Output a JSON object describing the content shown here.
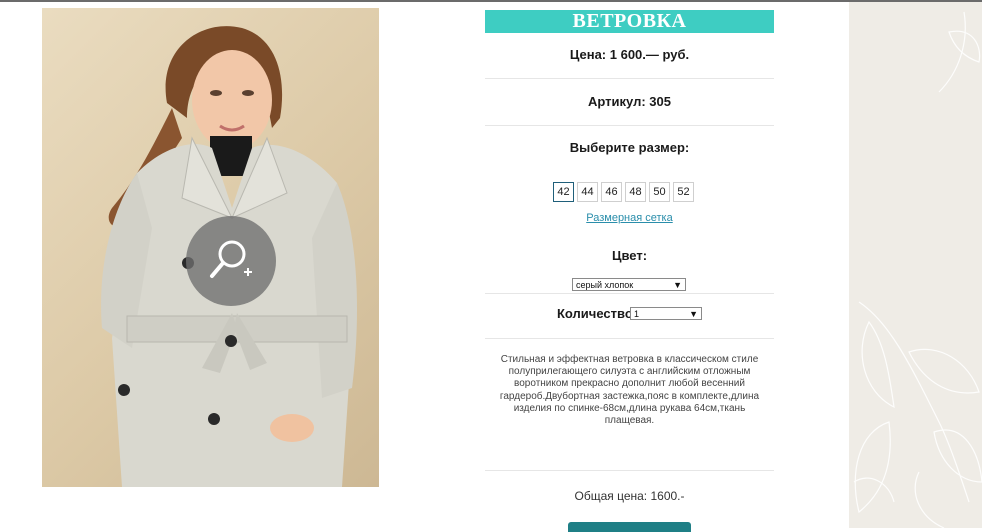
{
  "product": {
    "title": "ВЕТРОВКА",
    "price": "Цена: 1 600.— руб.",
    "article": "Артикул: 305",
    "choose_size_label": "Выберите размер:",
    "sizes": [
      "42",
      "44",
      "46",
      "48",
      "50",
      "52"
    ],
    "selected_size": "42",
    "size_chart_link": "Размерная сетка",
    "color_label": "Цвет:",
    "color_value": "серый хлопок",
    "quantity_label": "Количество:",
    "quantity_value": "1",
    "description": "Стильная и эффектная ветровка в классическом стиле полуприлегающего силуэта с английским отложным воротником прекрасно дополнит любой весенний гардероб.Двубортная застежка,пояс в комплекте,длина изделия по спинке-68см,длина рукава 64см,ткань плащевая.",
    "total": "Общая цена: 1600.-"
  },
  "icons": {
    "zoom": "zoom-in-icon",
    "dropdown": "chevron-down-icon"
  },
  "colors": {
    "accent": "#3ecdc2",
    "link": "#2a8eab",
    "button": "#1f7f86"
  }
}
